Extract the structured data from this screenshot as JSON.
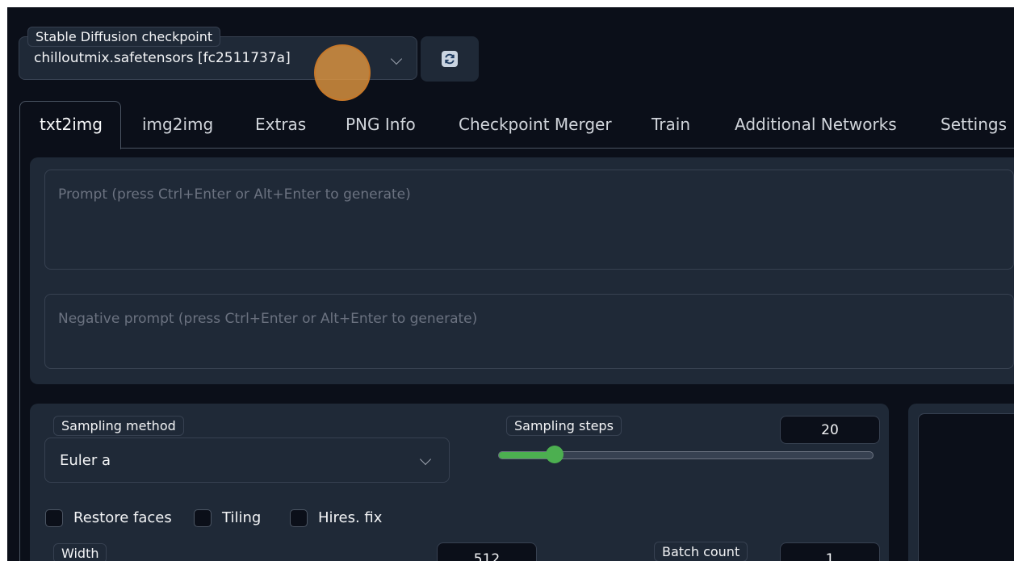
{
  "checkpoint": {
    "label": "Stable Diffusion checkpoint",
    "value": "chilloutmix.safetensors [fc2511737a]",
    "icon": "chevron-down-icon",
    "refresh_icon": "refresh-icon"
  },
  "tabs": [
    {
      "label": "txt2img",
      "active": true
    },
    {
      "label": "img2img"
    },
    {
      "label": "Extras"
    },
    {
      "label": "PNG Info"
    },
    {
      "label": "Checkpoint Merger"
    },
    {
      "label": "Train"
    },
    {
      "label": "Additional Networks"
    },
    {
      "label": "Settings"
    }
  ],
  "prompt": {
    "placeholder": "Prompt (press Ctrl+Enter or Alt+Enter to generate)",
    "value": ""
  },
  "negative_prompt": {
    "placeholder": "Negative prompt (press Ctrl+Enter or Alt+Enter to generate)",
    "value": ""
  },
  "sampling": {
    "method_label": "Sampling method",
    "method_value": "Euler a",
    "steps_label": "Sampling steps",
    "steps_value": "20",
    "steps_fraction": 0.15
  },
  "checkboxes": [
    {
      "label": "Restore faces",
      "checked": false
    },
    {
      "label": "Tiling",
      "checked": false
    },
    {
      "label": "Hires. fix",
      "checked": false
    }
  ],
  "width": {
    "label": "Width",
    "value": "512"
  },
  "batch_count": {
    "label": "Batch count",
    "value": "1"
  },
  "colors": {
    "background": "#0b0f19",
    "panel": "#1f2937",
    "accent": "#4caf50",
    "cursor": "#e29740"
  }
}
